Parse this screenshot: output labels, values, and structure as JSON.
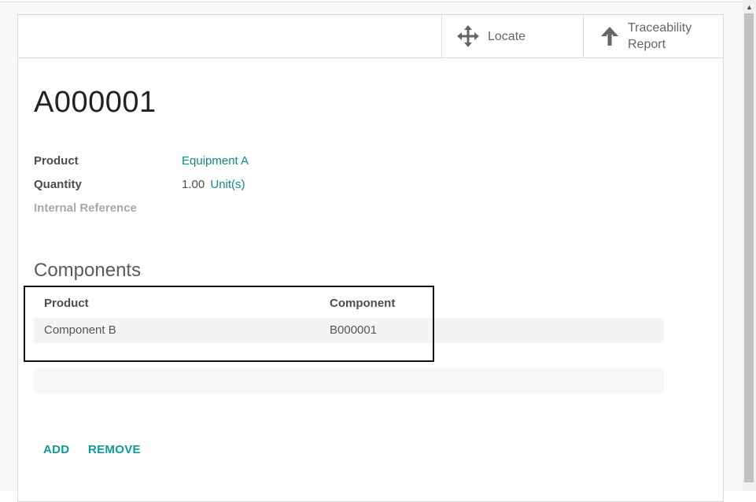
{
  "header": {
    "buttons": [
      {
        "label": "Locate",
        "icon": "arrows-move-icon"
      },
      {
        "label_line1": "Traceability",
        "label_line2": "Report",
        "icon": "arrow-up-icon"
      }
    ]
  },
  "lot": {
    "name": "A000001"
  },
  "fields": {
    "product_label": "Product",
    "product_value": "Equipment A",
    "quantity_label": "Quantity",
    "quantity_value": "1.00",
    "quantity_uom": "Unit(s)",
    "internal_ref_label": "Internal Reference"
  },
  "components": {
    "title": "Components",
    "columns": [
      "Product",
      "Component"
    ],
    "rows": [
      {
        "product": "Component B",
        "component": "B000001"
      }
    ]
  },
  "actions": {
    "add_label": "ADD",
    "remove_label": "REMOVE"
  },
  "colors": {
    "link": "#0e8a8a",
    "action": "#0e9a96"
  }
}
